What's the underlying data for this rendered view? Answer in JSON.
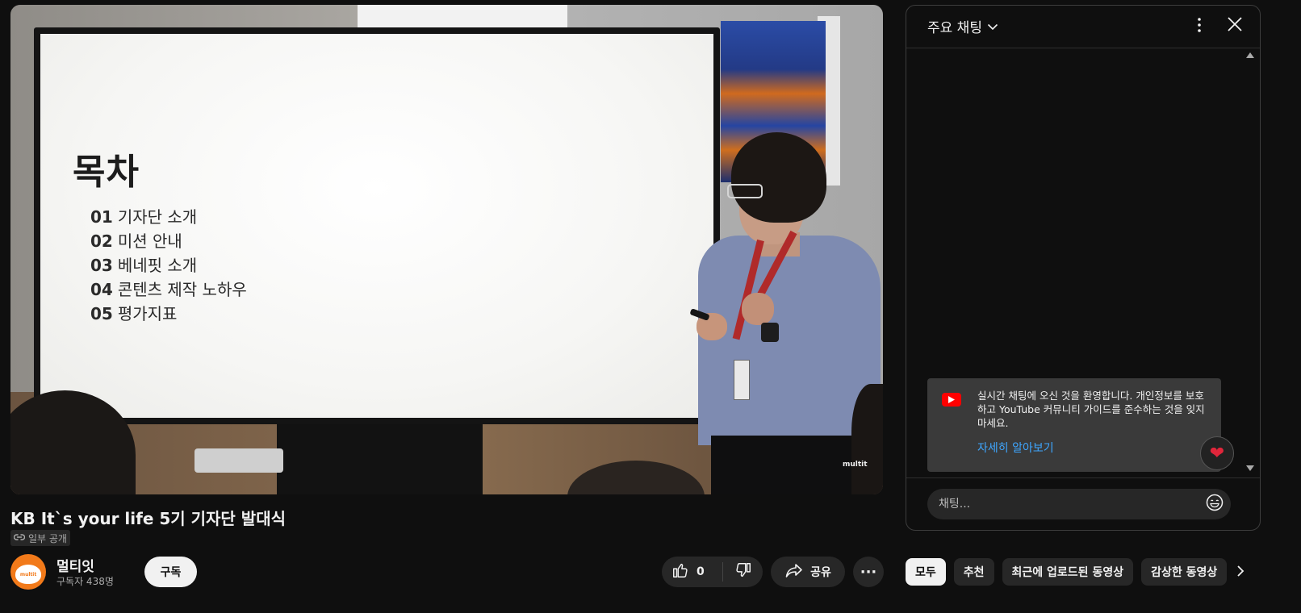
{
  "video": {
    "slide": {
      "title": "목차",
      "items": [
        {
          "num": "01",
          "text": "기자단 소개"
        },
        {
          "num": "02",
          "text": "미션 안내"
        },
        {
          "num": "03",
          "text": "베네핏 소개"
        },
        {
          "num": "04",
          "text": "콘텐츠 제작 노하우"
        },
        {
          "num": "05",
          "text": "평가지표"
        }
      ]
    },
    "watermark": "multit"
  },
  "title": "KB It`s your life 5기 기자단 발대식",
  "privacy_label": "일부 공개",
  "channel": {
    "avatar_text": "multit",
    "name": "멀티잇",
    "subscribers": "구독자 438명",
    "subscribe_label": "구독"
  },
  "actions": {
    "like_count": "0",
    "share_label": "공유",
    "more_label": "···"
  },
  "chat": {
    "mode_label": "주요 채팅",
    "welcome_text": "실시간 채팅에 오신 것을 환영합니다. 개인정보를 보호하고 YouTube 커뮤니티 가이드를 준수하는 것을 잊지 마세요.",
    "learn_more": "자세히 알아보기",
    "input_placeholder": "채팅..."
  },
  "chips": [
    "모두",
    "추천",
    "최근에 업로드된 동영상",
    "감상한 동영상"
  ],
  "colors": {
    "background": "#0f0f0f",
    "surface": "#272727",
    "link": "#3ea6ff",
    "brand_red": "#ff0000",
    "channel_orange": "#f27a1a"
  }
}
